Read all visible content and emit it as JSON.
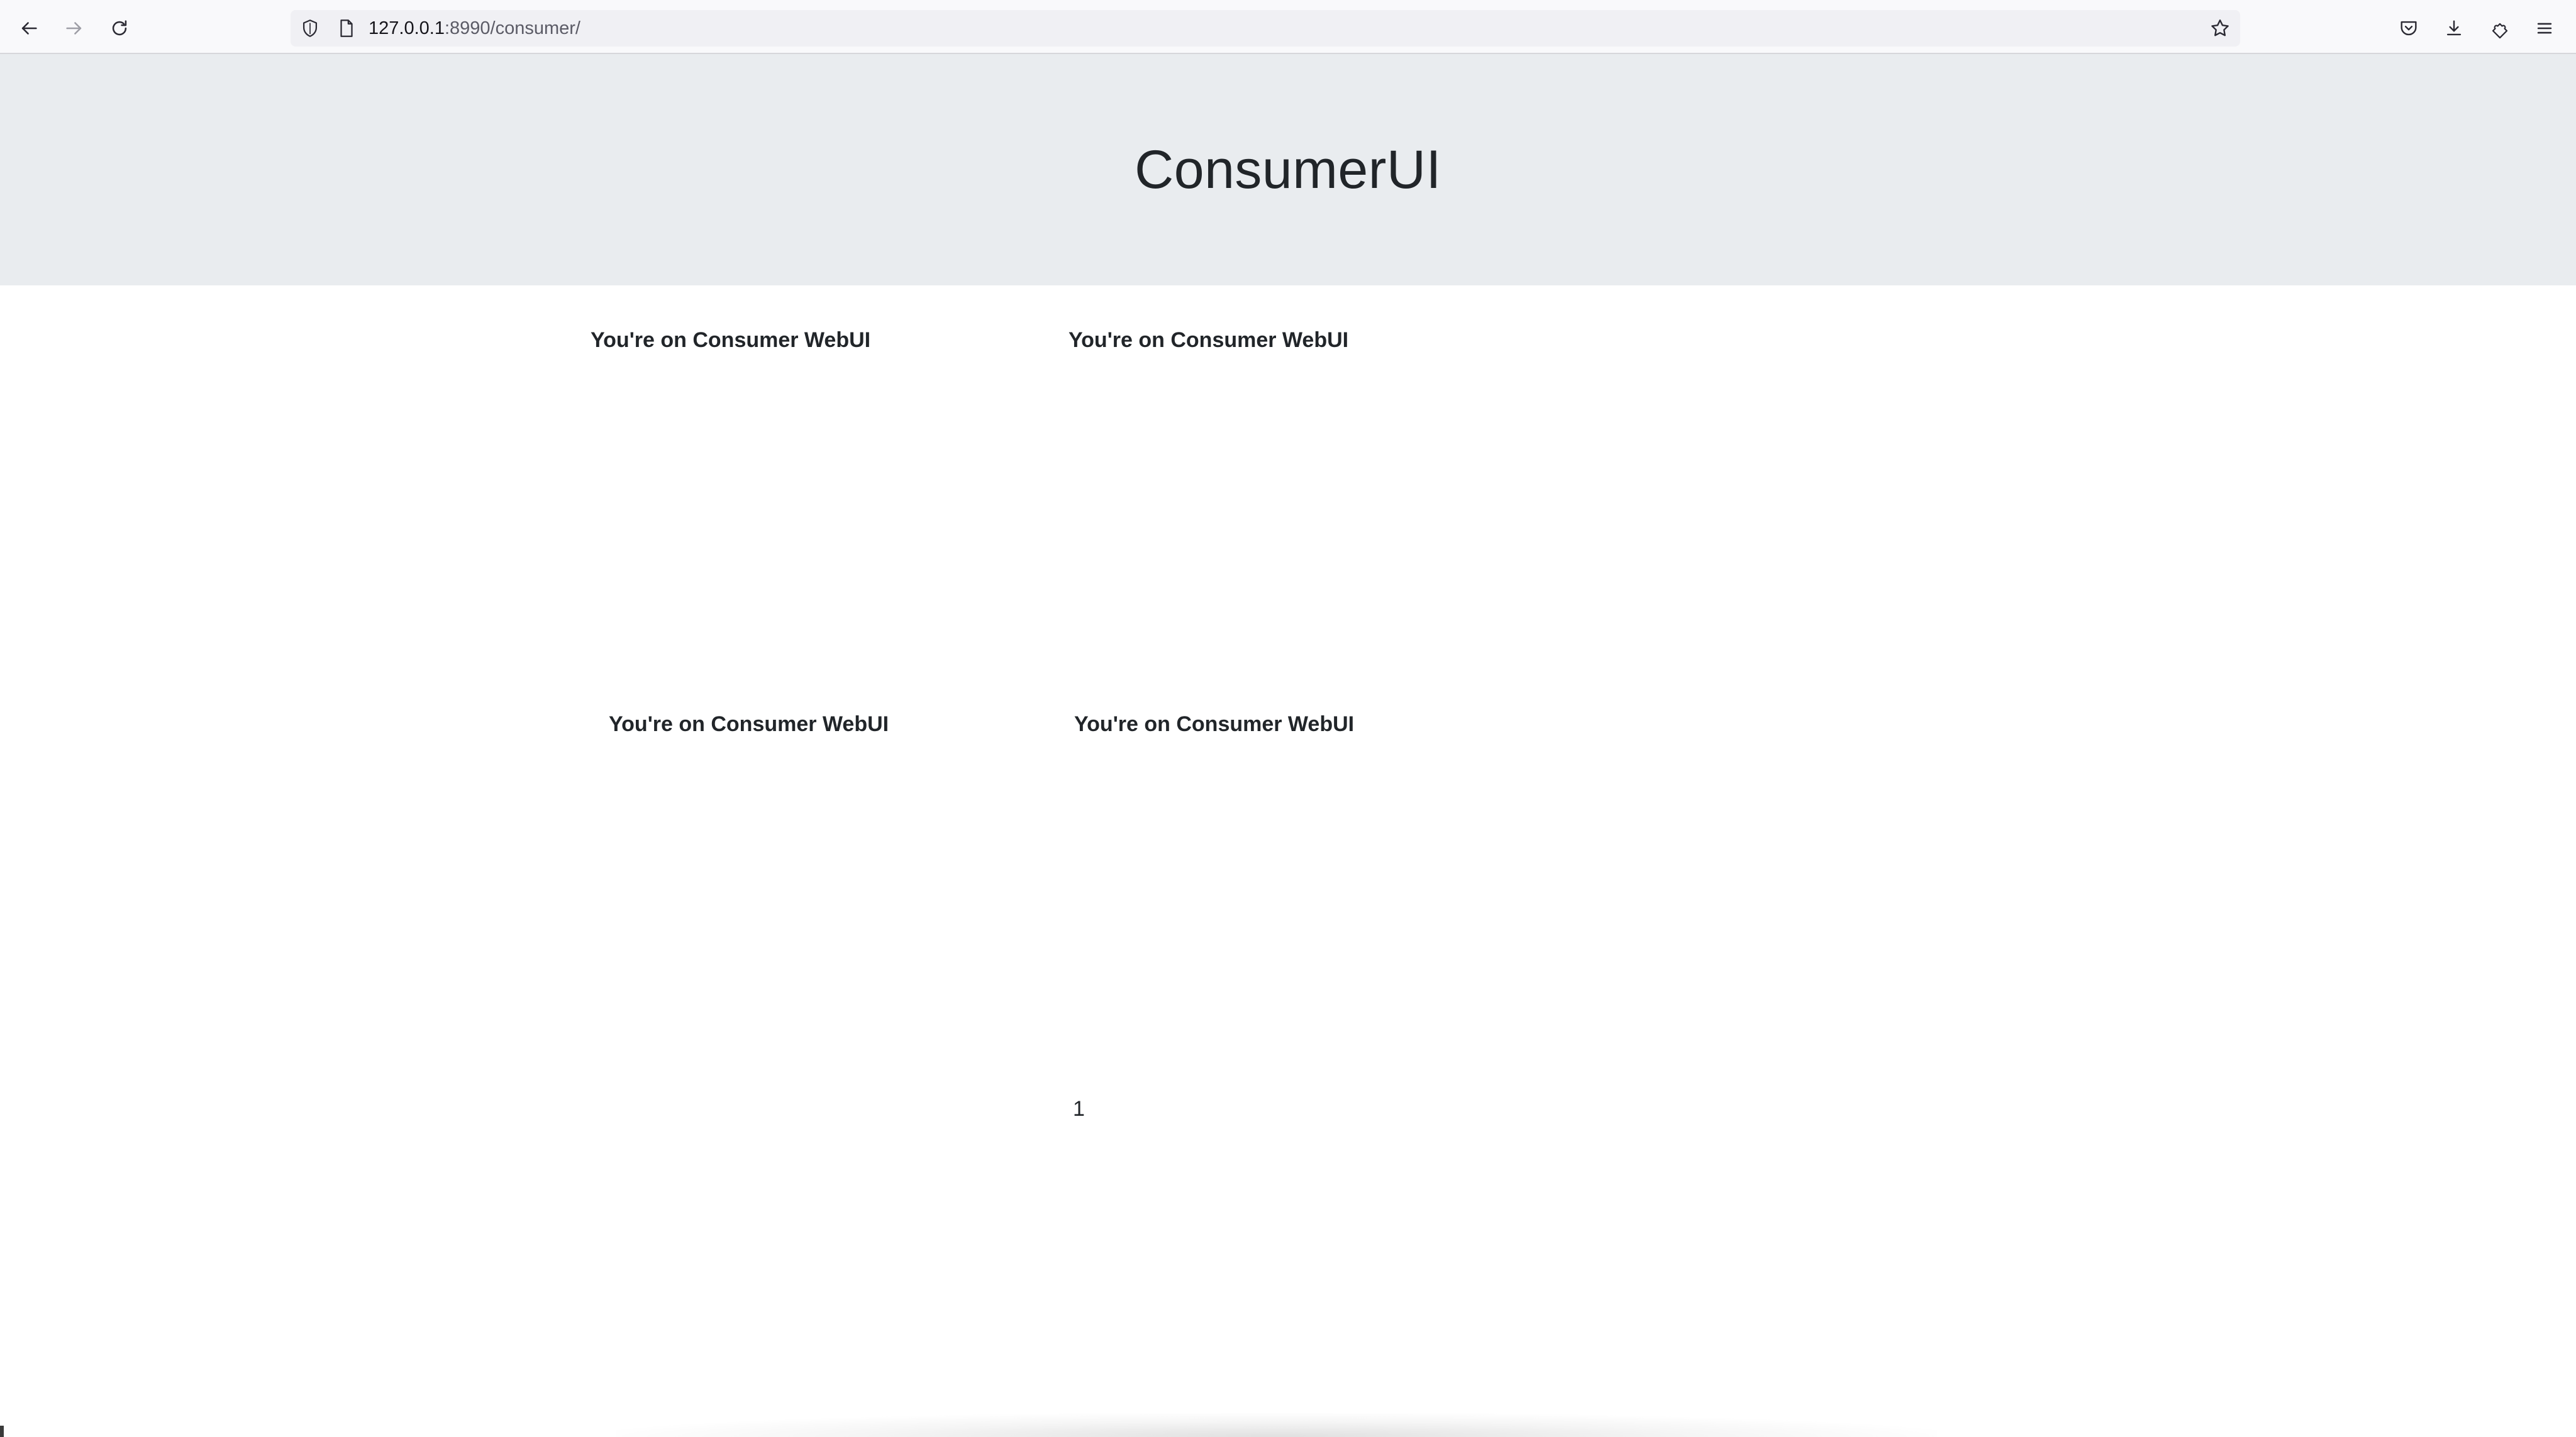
{
  "browser": {
    "url_host": "127.0.0.1",
    "url_path": ":8990/consumer/",
    "icons": {
      "back": "back-arrow-icon",
      "forward": "forward-arrow-icon",
      "reload": "reload-icon",
      "tracking": "shield-icon",
      "page": "page-icon",
      "bookmark": "star-icon",
      "pocket": "pocket-icon",
      "downloads": "download-icon",
      "extensions": "puzzle-icon",
      "menu": "hamburger-menu-icon"
    }
  },
  "header": {
    "title": "ConsumerUI"
  },
  "cards": [
    {
      "title": "You're on Consumer WebUI"
    },
    {
      "title": "You're on Consumer WebUI"
    },
    {
      "title": "You're on Consumer WebUI"
    },
    {
      "title": "You're on Consumer WebUI"
    }
  ],
  "pagination": {
    "current": "1"
  }
}
